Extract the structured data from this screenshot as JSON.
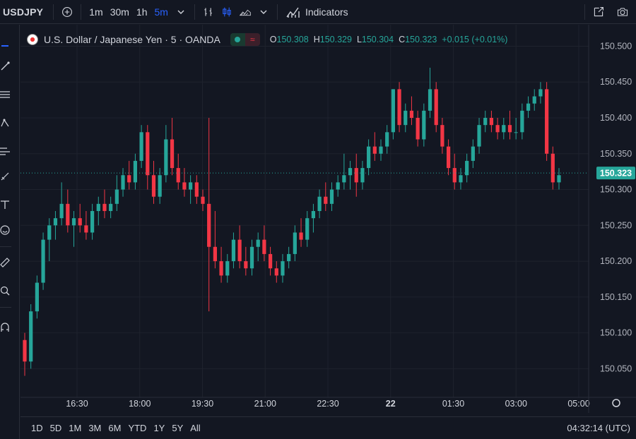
{
  "toolbar": {
    "symbol": "USDJPY",
    "intervals": [
      {
        "label": "1m",
        "active": false
      },
      {
        "label": "30m",
        "active": false
      },
      {
        "label": "1h",
        "active": false
      },
      {
        "label": "5m",
        "active": true
      }
    ],
    "indicators_label": "Indicators",
    "accent_color": "#2962ff"
  },
  "legend": {
    "title": "U.S. Dollar / Japanese Yen · 5 · OANDA",
    "open_key": "O",
    "open": "150.308",
    "high_key": "H",
    "high": "150.329",
    "low_key": "L",
    "low": "150.304",
    "close_key": "C",
    "close": "150.323",
    "change": "+0.015 (+0.01%)"
  },
  "bottom": {
    "ranges": [
      "1D",
      "5D",
      "1M",
      "3M",
      "6M",
      "YTD",
      "1Y",
      "5Y",
      "All"
    ],
    "time": "04:32:14 (UTC)"
  },
  "chart_data": {
    "type": "candlestick",
    "up_color": "#26a69a",
    "down_color": "#f23645",
    "price_labels": [
      "150.500",
      "150.450",
      "150.400",
      "150.350",
      "150.300",
      "150.250",
      "150.200",
      "150.150",
      "150.100",
      "150.050"
    ],
    "time_labels": [
      {
        "label": "16:30",
        "bold": false
      },
      {
        "label": "18:00",
        "bold": false
      },
      {
        "label": "19:30",
        "bold": false
      },
      {
        "label": "21:00",
        "bold": false
      },
      {
        "label": "22:30",
        "bold": false
      },
      {
        "label": "22",
        "bold": true
      },
      {
        "label": "01:30",
        "bold": false
      },
      {
        "label": "03:00",
        "bold": false
      },
      {
        "label": "05:00",
        "bold": false
      }
    ],
    "last_price": "150.323",
    "ylim": [
      150.01,
      150.53
    ],
    "candles": [
      [
        150.09,
        150.1,
        150.04,
        150.06
      ],
      [
        150.06,
        150.14,
        150.05,
        150.13
      ],
      [
        150.13,
        150.18,
        150.12,
        150.17
      ],
      [
        150.17,
        150.24,
        150.16,
        150.23
      ],
      [
        150.23,
        150.26,
        150.2,
        150.25
      ],
      [
        150.25,
        150.27,
        150.23,
        150.26
      ],
      [
        150.26,
        150.31,
        150.25,
        150.28
      ],
      [
        150.28,
        150.3,
        150.24,
        150.25
      ],
      [
        150.25,
        150.27,
        150.22,
        150.26
      ],
      [
        150.26,
        150.28,
        150.24,
        150.25
      ],
      [
        150.25,
        150.27,
        150.23,
        150.24
      ],
      [
        150.24,
        150.28,
        150.23,
        150.27
      ],
      [
        150.27,
        150.29,
        150.25,
        150.28
      ],
      [
        150.28,
        150.3,
        150.26,
        150.27
      ],
      [
        150.27,
        150.29,
        150.26,
        150.28
      ],
      [
        150.28,
        150.32,
        150.27,
        150.3
      ],
      [
        150.3,
        150.33,
        150.29,
        150.32
      ],
      [
        150.32,
        150.34,
        150.3,
        150.31
      ],
      [
        150.31,
        150.35,
        150.3,
        150.34
      ],
      [
        150.34,
        150.39,
        150.33,
        150.38
      ],
      [
        150.38,
        150.39,
        150.3,
        150.32
      ],
      [
        150.32,
        150.34,
        150.28,
        150.29
      ],
      [
        150.29,
        150.33,
        150.28,
        150.32
      ],
      [
        150.32,
        150.39,
        150.31,
        150.37
      ],
      [
        150.37,
        150.4,
        150.32,
        150.33
      ],
      [
        150.33,
        150.35,
        150.3,
        150.31
      ],
      [
        150.31,
        150.33,
        150.29,
        150.3
      ],
      [
        150.3,
        150.32,
        150.28,
        150.31
      ],
      [
        150.31,
        150.32,
        150.28,
        150.29
      ],
      [
        150.29,
        150.3,
        150.27,
        150.28
      ],
      [
        150.28,
        150.4,
        150.13,
        150.22
      ],
      [
        150.22,
        150.27,
        150.19,
        150.2
      ],
      [
        150.2,
        150.22,
        150.17,
        150.18
      ],
      [
        150.18,
        150.21,
        150.17,
        150.2
      ],
      [
        150.2,
        150.24,
        150.19,
        150.23
      ],
      [
        150.23,
        150.25,
        150.19,
        150.2
      ],
      [
        150.2,
        150.22,
        150.18,
        150.19
      ],
      [
        150.19,
        150.23,
        150.18,
        150.22
      ],
      [
        150.22,
        150.24,
        150.2,
        150.23
      ],
      [
        150.23,
        150.25,
        150.2,
        150.21
      ],
      [
        150.21,
        150.22,
        150.18,
        150.19
      ],
      [
        150.19,
        150.2,
        150.17,
        150.18
      ],
      [
        150.18,
        150.21,
        150.17,
        150.2
      ],
      [
        150.2,
        150.22,
        150.19,
        150.21
      ],
      [
        150.21,
        150.25,
        150.2,
        150.24
      ],
      [
        150.24,
        150.26,
        150.22,
        150.23
      ],
      [
        150.23,
        150.27,
        150.22,
        150.26
      ],
      [
        150.26,
        150.28,
        150.24,
        150.27
      ],
      [
        150.27,
        150.3,
        150.26,
        150.29
      ],
      [
        150.29,
        150.31,
        150.27,
        150.28
      ],
      [
        150.28,
        150.31,
        150.27,
        150.3
      ],
      [
        150.3,
        150.32,
        150.29,
        150.31
      ],
      [
        150.31,
        150.35,
        150.3,
        150.32
      ],
      [
        150.32,
        150.34,
        150.3,
        150.33
      ],
      [
        150.33,
        150.35,
        150.29,
        150.31
      ],
      [
        150.31,
        150.34,
        150.3,
        150.33
      ],
      [
        150.33,
        150.37,
        150.32,
        150.36
      ],
      [
        150.36,
        150.38,
        150.34,
        150.35
      ],
      [
        150.35,
        150.37,
        150.34,
        150.36
      ],
      [
        150.36,
        150.39,
        150.35,
        150.38
      ],
      [
        150.38,
        150.44,
        150.37,
        150.44
      ],
      [
        150.44,
        150.45,
        150.38,
        150.39
      ],
      [
        150.39,
        150.42,
        150.38,
        150.41
      ],
      [
        150.41,
        150.43,
        150.39,
        150.4
      ],
      [
        150.4,
        150.41,
        150.36,
        150.37
      ],
      [
        150.37,
        150.42,
        150.36,
        150.41
      ],
      [
        150.41,
        150.47,
        150.4,
        150.44
      ],
      [
        150.44,
        150.45,
        150.38,
        150.39
      ],
      [
        150.39,
        150.4,
        150.35,
        150.36
      ],
      [
        150.36,
        150.37,
        150.32,
        150.33
      ],
      [
        150.33,
        150.35,
        150.3,
        150.31
      ],
      [
        150.31,
        150.33,
        150.3,
        150.32
      ],
      [
        150.32,
        150.35,
        150.31,
        150.34
      ],
      [
        150.34,
        150.37,
        150.33,
        150.36
      ],
      [
        150.36,
        150.4,
        150.35,
        150.39
      ],
      [
        150.39,
        150.41,
        150.38,
        150.4
      ],
      [
        150.4,
        150.41,
        150.38,
        150.39
      ],
      [
        150.39,
        150.4,
        150.37,
        150.38
      ],
      [
        150.38,
        150.4,
        150.37,
        150.39
      ],
      [
        150.39,
        150.41,
        150.37,
        150.38
      ],
      [
        150.38,
        150.4,
        150.37,
        150.38
      ],
      [
        150.38,
        150.42,
        150.37,
        150.41
      ],
      [
        150.41,
        150.43,
        150.4,
        150.42
      ],
      [
        150.42,
        150.44,
        150.41,
        150.43
      ],
      [
        150.43,
        150.45,
        150.42,
        150.44
      ],
      [
        150.44,
        150.45,
        150.34,
        150.35
      ],
      [
        150.35,
        150.36,
        150.3,
        150.31
      ],
      [
        150.31,
        150.33,
        150.3,
        150.32
      ]
    ]
  }
}
